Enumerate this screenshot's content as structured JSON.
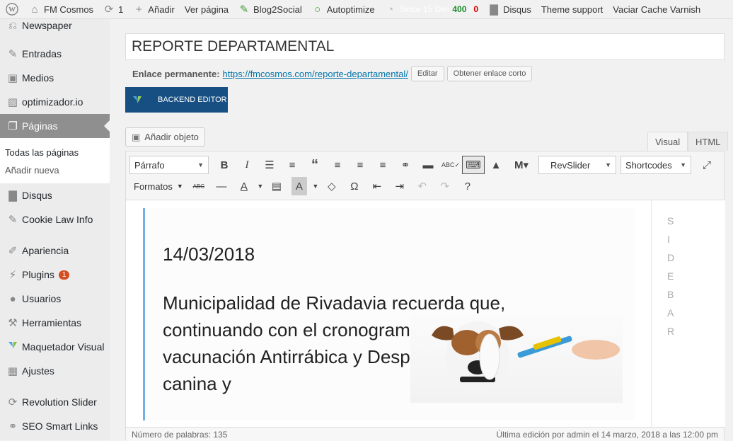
{
  "adminbar": {
    "site_name": "FM Cosmos",
    "updates_count": "1",
    "add_new": "Añadir",
    "view_page": "Ver página",
    "blog2social": "Blog2Social",
    "autoptimize": "Autoptimize",
    "since_label": "Since 15 Dec",
    "since_good": "400",
    "since_bad": "0",
    "disqus": "Disqus",
    "theme_support": "Theme support",
    "purge_varnish": "Vaciar Cache Varnish"
  },
  "sidebar": {
    "items": [
      {
        "label": "Newspaper",
        "icon": "newspaper-icon"
      },
      {
        "label": "Entradas",
        "icon": "pin-icon"
      },
      {
        "label": "Medios",
        "icon": "media-icon"
      },
      {
        "label": "optimizador.io",
        "icon": "image-icon"
      },
      {
        "label": "Páginas",
        "icon": "pages-icon"
      },
      {
        "label": "Disqus",
        "icon": "comment-icon"
      },
      {
        "label": "Cookie Law Info",
        "icon": "pin-icon"
      },
      {
        "label": "Apariencia",
        "icon": "brush-icon"
      },
      {
        "label": "Plugins",
        "icon": "plugin-icon",
        "badge": "1"
      },
      {
        "label": "Usuarios",
        "icon": "user-icon"
      },
      {
        "label": "Herramientas",
        "icon": "wrench-icon"
      },
      {
        "label": "Maquetador Visual",
        "icon": "vc-icon"
      },
      {
        "label": "Ajustes",
        "icon": "settings-icon"
      },
      {
        "label": "Revolution Slider",
        "icon": "refresh-icon"
      },
      {
        "label": "SEO Smart Links",
        "icon": "link-icon"
      }
    ],
    "submenu": {
      "all_pages": "Todas las páginas",
      "add_new": "Añadir nueva"
    }
  },
  "editor": {
    "title": "REPORTE DEPARTAMENTAL",
    "permalink_label": "Enlace permanente:",
    "permalink_base": "https://fmcosmos.com/",
    "permalink_slug": "reporte-departamental",
    "permalink_trailing": "/",
    "edit_button": "Editar",
    "shortlink_button": "Obtener enlace corto",
    "backend_editor": "BACKEND EDITOR",
    "add_media": "Añadir objeto",
    "tab_visual": "Visual",
    "tab_html": "HTML",
    "format_select": "Párrafo",
    "formats_drop": "Formatos",
    "revslider_select": "RevSlider",
    "shortcodes_select": "Shortcodes",
    "content_date": "14/03/2018",
    "content_text": "Municipalidad de Rivadavia recuerda que, continuando con el cronograma de vacunación Antirrábica y Desparasitación canina y",
    "sidebar_letters": [
      "S",
      "I",
      "D",
      "E",
      "B",
      "A",
      "R"
    ],
    "word_count": "Número de palabras: 135",
    "last_edit": "Última edición por admin el 14 marzo, 2018 a las 12:00 pm"
  },
  "colors": {
    "accent": "#174f82",
    "active_menu": "#8f8f8f",
    "badge": "#d54e21",
    "link": "#0073aa"
  }
}
